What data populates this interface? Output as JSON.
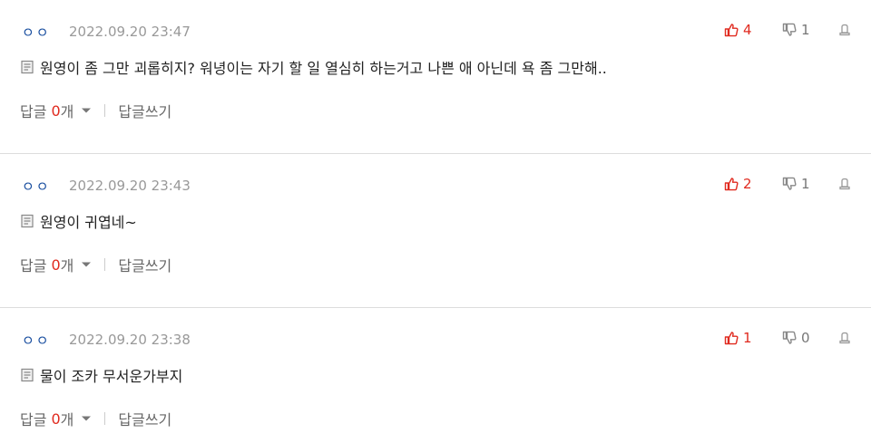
{
  "comments": [
    {
      "nickname": "ㅇㅇ",
      "date": "2022.09.20 23:47",
      "upvotes": "4",
      "downvotes": "1",
      "text": "원영이 좀 그만 괴롭히지? 워녕이는 자기 할 일 열심히 하는거고 나쁜 애 아닌데 욕 좀 그만해..",
      "reply_label": "답글",
      "reply_count": "0",
      "reply_unit": "개",
      "write_label": "답글쓰기"
    },
    {
      "nickname": "ㅇㅇ",
      "date": "2022.09.20 23:43",
      "upvotes": "2",
      "downvotes": "1",
      "text": "원영이 귀엽네~",
      "reply_label": "답글",
      "reply_count": "0",
      "reply_unit": "개",
      "write_label": "답글쓰기"
    },
    {
      "nickname": "ㅇㅇ",
      "date": "2022.09.20 23:38",
      "upvotes": "1",
      "downvotes": "0",
      "text": "물이 조카 무서운가부지",
      "reply_label": "답글",
      "reply_count": "0",
      "reply_unit": "개",
      "write_label": "답글쓰기"
    }
  ],
  "icons": {
    "upvote": "thumbs-up-icon",
    "downvote": "thumbs-down-icon",
    "report": "report-icon",
    "memo": "memo-icon",
    "caret": "caret-down-icon"
  },
  "colors": {
    "accent_red": "#e02a1f",
    "nickname_blue": "#1a4fa0",
    "meta_gray": "#999999",
    "divider": "#dddddd"
  }
}
